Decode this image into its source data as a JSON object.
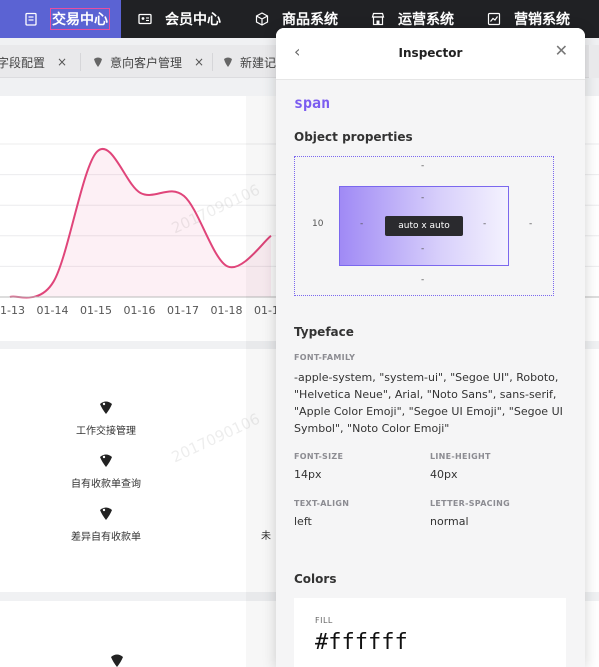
{
  "nav": {
    "items": [
      {
        "label": "交易中心",
        "icon": "clipboard-icon"
      },
      {
        "label": "会员中心",
        "icon": "id-card-icon"
      },
      {
        "label": "商品系统",
        "icon": "cube-icon"
      },
      {
        "label": "运营系统",
        "icon": "store-icon"
      },
      {
        "label": "营销系统",
        "icon": "chart-icon"
      }
    ]
  },
  "tabs": [
    {
      "label": "字段配置",
      "close": "×"
    },
    {
      "label": "意向客户管理",
      "close": "×"
    },
    {
      "label": "新建记"
    }
  ],
  "chart_data": {
    "type": "area",
    "x": [
      "01-13",
      "01-14",
      "01-15",
      "01-16",
      "01-17",
      "01-18",
      "01-1"
    ],
    "series": [
      {
        "values": [
          0,
          10,
          95,
          68,
          66,
          20,
          40
        ],
        "color": "#e0457a"
      }
    ],
    "grid": true
  },
  "watermark": "2017090106",
  "quick_menu": [
    {
      "label": "工作交接管理",
      "icon": "hawk-icon"
    },
    {
      "label": "自有收款单查询",
      "icon": "hawk-icon"
    },
    {
      "label": "差异自有收款单",
      "icon": "hawk-icon"
    },
    {
      "label": "未"
    }
  ],
  "inspector": {
    "title": "Inspector",
    "element": "span",
    "object_properties_title": "Object properties",
    "box": {
      "margin_top": "-",
      "margin_right": "-",
      "margin_bottom": "-",
      "margin_left": "10",
      "padding_top": "-",
      "padding_right": "-",
      "padding_bottom": "-",
      "padding_left": "-",
      "content": "auto x auto"
    },
    "typeface_title": "Typeface",
    "font_family_label": "FONT-FAMILY",
    "font_family": "-apple-system, \"system-ui\", \"Segoe UI\", Roboto, \"Helvetica Neue\", Arial, \"Noto Sans\", sans-serif, \"Apple Color Emoji\", \"Segoe UI Emoji\", \"Segoe UI Symbol\", \"Noto Color Emoji\"",
    "font_size_label": "FONT-SIZE",
    "font_size": "14px",
    "line_height_label": "LINE-HEIGHT",
    "line_height": "40px",
    "text_align_label": "TEXT-ALIGN",
    "text_align": "left",
    "letter_spacing_label": "LETTER-SPACING",
    "letter_spacing": "normal",
    "colors_title": "Colors",
    "fill_label": "FILL",
    "fill_value": "#ffffff"
  }
}
